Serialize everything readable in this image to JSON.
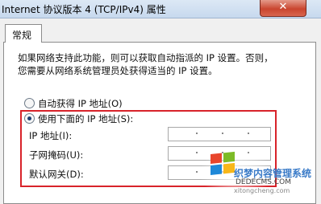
{
  "window": {
    "title": "Internet 协议版本 4 (TCP/IPv4) 属性",
    "close_label": "✕"
  },
  "tabs": [
    {
      "label": "常规",
      "active": true
    }
  ],
  "description": {
    "line1": "如果网络支持此功能，则可以获取自动指派的 IP 设置。否则，",
    "line2": "您需要从网络系统管理员处获得适当的 IP 设置。"
  },
  "options": {
    "auto_ip": {
      "label": "自动获得 IP 地址(O)",
      "checked": false
    },
    "manual_ip": {
      "label": "使用下面的 IP 地址(S):",
      "checked": true
    }
  },
  "fields": [
    {
      "label": "IP 地址(I):",
      "value": ""
    },
    {
      "label": "子网掩码(U):",
      "value": ""
    },
    {
      "label": "默认网关(D):",
      "value": ""
    }
  ],
  "watermark": {
    "text1": "织梦内容管理系统",
    "text2": "DEDECMS.COM",
    "text3": "xitongcheng.com"
  },
  "colors": {
    "highlight": "#d8232a",
    "titlebar": "#c7d9ee"
  }
}
